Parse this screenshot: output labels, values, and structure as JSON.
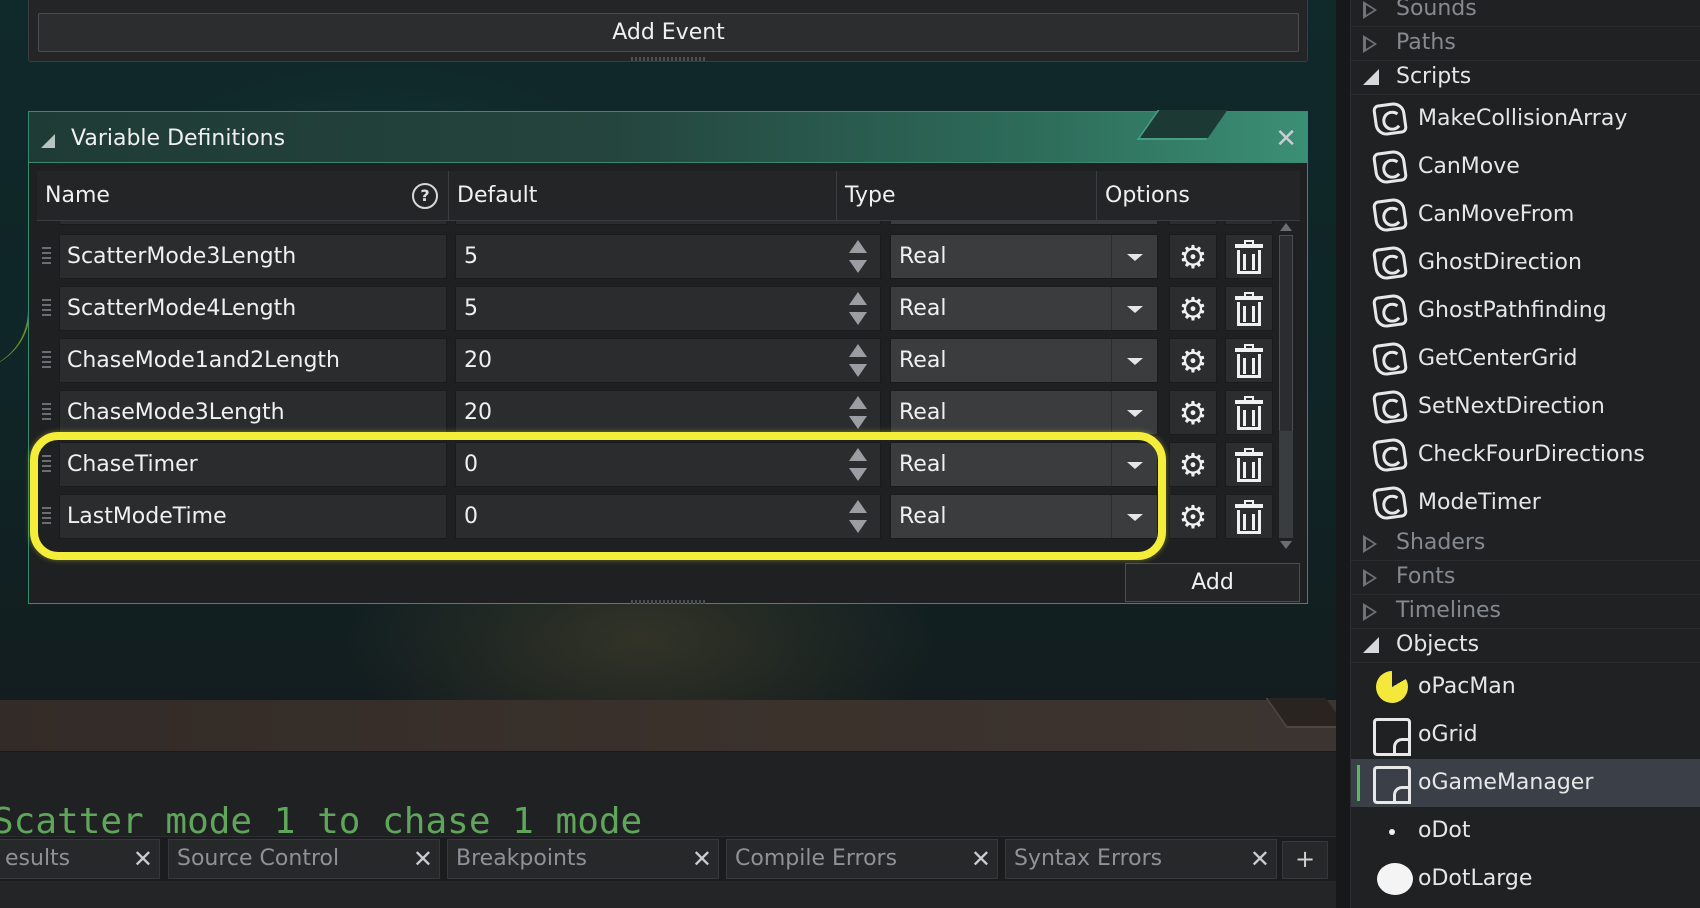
{
  "event_panel": {
    "add_event_label": "Add Event"
  },
  "variable_window": {
    "title": "Variable Definitions",
    "close_icon": "close-x-icon",
    "columns": {
      "name": "Name",
      "default": "Default",
      "type": "Type",
      "options": "Options"
    },
    "help_icon": "?",
    "rows": [
      {
        "name": "ScatterMode3Length",
        "default": "5",
        "type": "Real"
      },
      {
        "name": "ScatterMode4Length",
        "default": "5",
        "type": "Real"
      },
      {
        "name": "ChaseMode1and2Length",
        "default": "20",
        "type": "Real"
      },
      {
        "name": "ChaseMode3Length",
        "default": "20",
        "type": "Real"
      },
      {
        "name": "ChaseTimer",
        "default": "0",
        "type": "Real"
      },
      {
        "name": "LastModeTime",
        "default": "0",
        "type": "Real"
      }
    ],
    "add_label": "Add",
    "highlight_color": "#f4ee3a"
  },
  "code_editor": {
    "visible_line": "Scatter mode 1 to chase 1 mode"
  },
  "output_tabs": {
    "tabs": [
      {
        "label": "esults"
      },
      {
        "label": "Source Control"
      },
      {
        "label": "Breakpoints"
      },
      {
        "label": "Compile Errors"
      },
      {
        "label": "Syntax Errors"
      }
    ],
    "close_glyph": "X",
    "add_glyph": "+"
  },
  "resource_tree": {
    "folders": {
      "sounds": "Sounds",
      "paths": "Paths",
      "scripts": "Scripts",
      "shaders": "Shaders",
      "fonts": "Fonts",
      "timelines": "Timelines",
      "objects": "Objects"
    },
    "scripts": [
      "MakeCollisionArray",
      "CanMove",
      "CanMoveFrom",
      "GhostDirection",
      "GhostPathfinding",
      "GetCenterGrid",
      "SetNextDirection",
      "CheckFourDirections",
      "ModeTimer"
    ],
    "objects": [
      "oPacMan",
      "oGrid",
      "oGameManager",
      "oDot",
      "oDotLarge"
    ],
    "selected_object": "oGameManager"
  }
}
